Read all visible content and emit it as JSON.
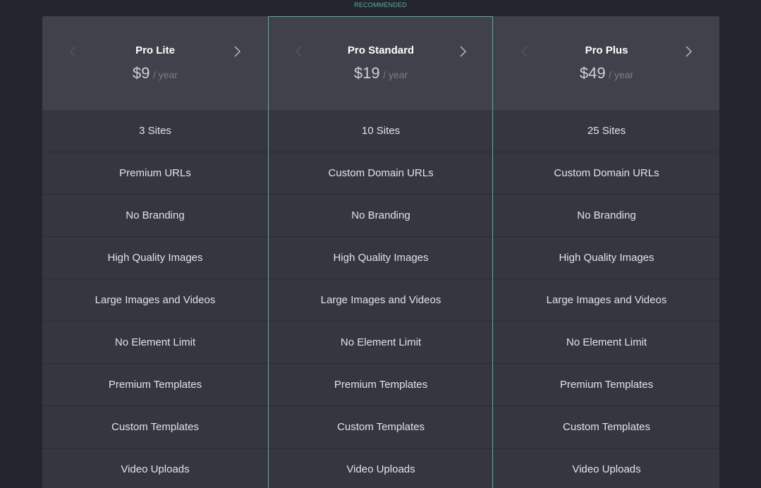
{
  "recommended_label": "RECOMMENDED",
  "plans": [
    {
      "name": "Pro Lite",
      "price": "$9",
      "period": "/ year",
      "features": [
        "3 Sites",
        "Premium URLs",
        "No Branding",
        "High Quality Images",
        "Large Images and Videos",
        "No Element Limit",
        "Premium Templates",
        "Custom Templates",
        "Video Uploads"
      ]
    },
    {
      "name": "Pro Standard",
      "price": "$19",
      "period": "/ year",
      "features": [
        "10 Sites",
        "Custom Domain URLs",
        "No Branding",
        "High Quality Images",
        "Large Images and Videos",
        "No Element Limit",
        "Premium Templates",
        "Custom Templates",
        "Video Uploads"
      ]
    },
    {
      "name": "Pro Plus",
      "price": "$49",
      "period": "/ year",
      "features": [
        "25 Sites",
        "Custom Domain URLs",
        "No Branding",
        "High Quality Images",
        "Large Images and Videos",
        "No Element Limit",
        "Premium Templates",
        "Custom Templates",
        "Video Uploads"
      ]
    }
  ],
  "icons": {
    "prev": "chevron-left-icon",
    "next": "chevron-right-icon"
  },
  "colors": {
    "background": "#25252d",
    "header": "#41414b",
    "body": "#363640",
    "accent": "#4fb3a0"
  }
}
